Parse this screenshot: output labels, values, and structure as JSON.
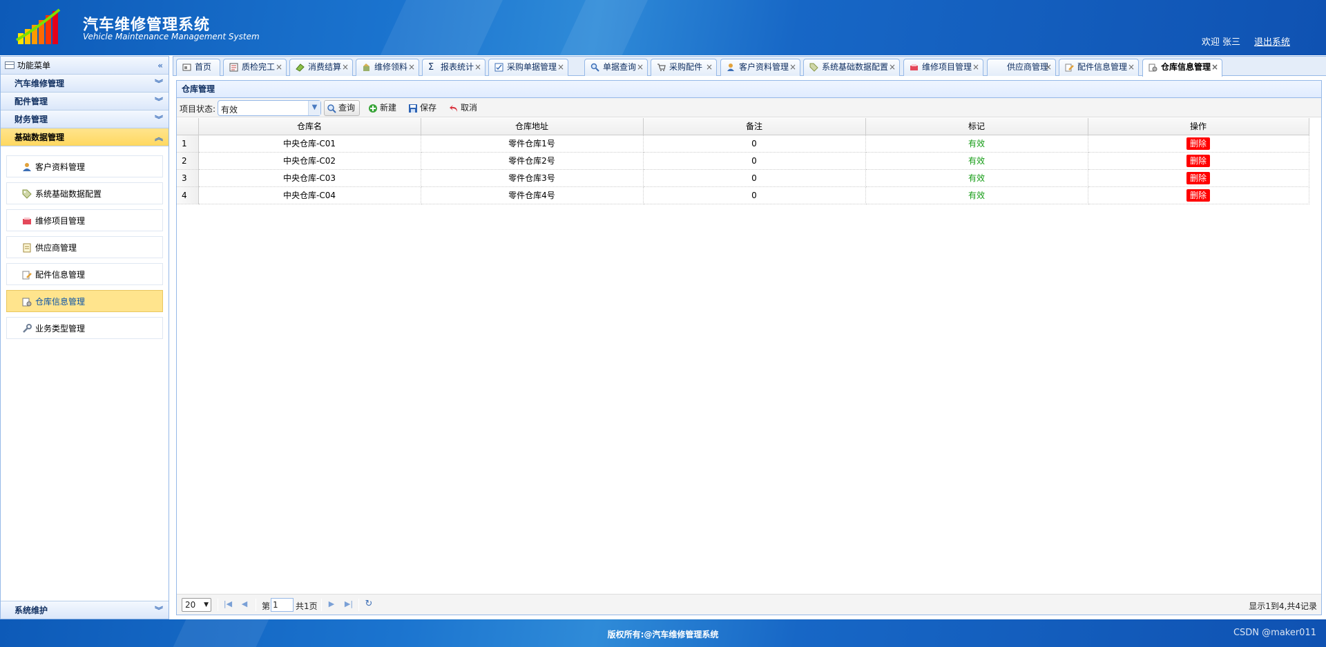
{
  "header": {
    "title": "汽车维修管理系统",
    "subtitle": "Vehicle Maintenance Management System",
    "welcome": "欢迎 张三",
    "logout": "退出系统"
  },
  "sidebar": {
    "menu_title": "功能菜单",
    "groups": [
      {
        "label": "汽车维修管理"
      },
      {
        "label": "配件管理"
      },
      {
        "label": "财务管理"
      },
      {
        "label": "基础数据管理"
      },
      {
        "label": "系统维护"
      }
    ],
    "items": [
      {
        "label": "客户资料管理",
        "icon": "customer-icon"
      },
      {
        "label": "系统基础数据配置",
        "icon": "tag-icon"
      },
      {
        "label": "维修项目管理",
        "icon": "repair-icon"
      },
      {
        "label": "供应商管理",
        "icon": "document-icon"
      },
      {
        "label": "配件信息管理",
        "icon": "edit-doc-icon"
      },
      {
        "label": "仓库信息管理",
        "icon": "warehouse-icon"
      },
      {
        "label": "业务类型管理",
        "icon": "wrench-icon"
      }
    ]
  },
  "tabs": [
    {
      "label": "首页"
    },
    {
      "label": "质检完工"
    },
    {
      "label": "消费结算"
    },
    {
      "label": "维修领料"
    },
    {
      "label": "报表统计"
    },
    {
      "label": "采购单据管理"
    },
    {
      "label": "单据查询"
    },
    {
      "label": "采购配件"
    },
    {
      "label": "客户资料管理"
    },
    {
      "label": "系统基础数据配置"
    },
    {
      "label": "维修项目管理"
    },
    {
      "label": "供应商管理"
    },
    {
      "label": "配件信息管理"
    },
    {
      "label": "仓库信息管理"
    }
  ],
  "tab_close": "×",
  "panel": {
    "title": "仓库管理",
    "status_label": "项目状态:",
    "status_value": "有效",
    "search_label": "查询",
    "new_label": "新建",
    "save_label": "保存",
    "cancel_label": "取消"
  },
  "grid": {
    "columns": [
      "仓库名",
      "仓库地址",
      "备注",
      "标记",
      "操作"
    ],
    "rows": [
      {
        "no": "1",
        "name": "中央仓库-C01",
        "address": "零件仓库1号",
        "remark": "0",
        "flag": "有效",
        "action": "删除"
      },
      {
        "no": "2",
        "name": "中央仓库-C02",
        "address": "零件仓库2号",
        "remark": "0",
        "flag": "有效",
        "action": "删除"
      },
      {
        "no": "3",
        "name": "中央仓库-C03",
        "address": "零件仓库3号",
        "remark": "0",
        "flag": "有效",
        "action": "删除"
      },
      {
        "no": "4",
        "name": "中央仓库-C04",
        "address": "零件仓库4号",
        "remark": "0",
        "flag": "有效",
        "action": "删除"
      }
    ]
  },
  "pager": {
    "page_size": "20",
    "page_pre": "第",
    "page_value": "1",
    "page_post": "共1页",
    "info": "显示1到4,共4记录"
  },
  "footer": {
    "copyright": "版权所有:@汽车维修管理系统",
    "watermark": "CSDN @maker011"
  },
  "colors": {
    "brand_blue": "#1b74cf",
    "selected_yellow": "#ffe48d",
    "delete_red": "#ff0000",
    "valid_green": "#159c15"
  }
}
